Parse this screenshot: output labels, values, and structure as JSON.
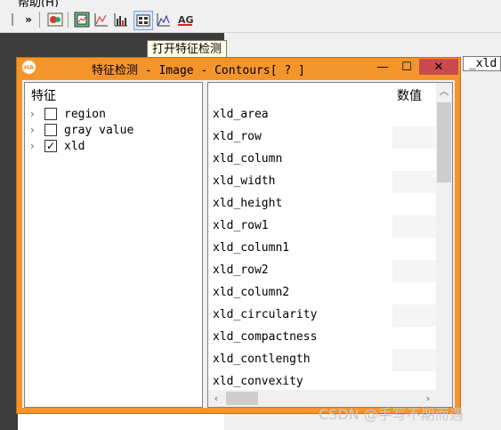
{
  "background": {
    "menu_fragment": "帮助(H)",
    "toolbar_chevron": "»",
    "right_input_value": "_xld",
    "tooltip": "打开特征检测"
  },
  "dialog": {
    "icon_text": "HA",
    "title": "特征检测 - Image - Contours[ ? ]",
    "controls": {
      "minimize": "—",
      "maximize": "☐",
      "close": "✕"
    },
    "tree": {
      "header": "特征",
      "items": [
        {
          "label": "region",
          "checked": false
        },
        {
          "label": "gray value",
          "checked": false
        },
        {
          "label": "xld",
          "checked": true
        }
      ]
    },
    "list": {
      "value_header": "数值",
      "rows": [
        "xld_area",
        "xld_row",
        "xld_column",
        "xld_width",
        "xld_height",
        "xld_row1",
        "xld_column1",
        "xld_row2",
        "xld_column2",
        "xld_circularity",
        "xld_compactness",
        "xld_contlength",
        "xld_convexity"
      ]
    }
  },
  "watermark": "CSDN @手写不期而遇",
  "colors": {
    "dialog_frame": "#f4952c",
    "close_button": "#c94a4a",
    "dark_panel": "#3c3c3c"
  }
}
